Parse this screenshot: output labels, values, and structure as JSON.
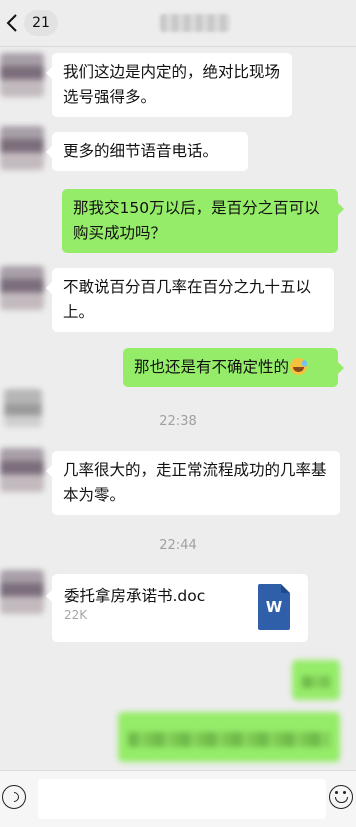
{
  "header": {
    "back_icon": "chevron-left-icon",
    "unread_count": "21"
  },
  "messages": [
    {
      "side": "left",
      "text": "我们这边是内定的，绝对比现场选号强得多。"
    },
    {
      "side": "left",
      "text": "更多的细节语音电话。"
    },
    {
      "side": "right",
      "text": "那我交150万以后，是百分之百可以购买成功吗？"
    },
    {
      "side": "left",
      "text": "不敢说百分百几率在百分之九十五以上。"
    },
    {
      "side": "right",
      "text": "那也还是有不确定性的",
      "emoji": "sweat-laugh-emoji"
    },
    {
      "type": "time",
      "text": "22:38"
    },
    {
      "side": "left",
      "text": "几率很大的，走正常流程成功的几率基本为零。"
    },
    {
      "type": "time",
      "text": "22:44"
    },
    {
      "side": "left",
      "type": "file",
      "file_name": "委托拿房承诺书.doc",
      "file_size": "22K",
      "file_icon": "word-doc-icon",
      "file_icon_letter": "W"
    }
  ],
  "colors": {
    "background": "#ededed",
    "bubble_left": "#ffffff",
    "bubble_right": "#95ec69",
    "time_text": "#a0a0a0"
  },
  "input_bar": {
    "voice_icon": "voice-icon",
    "emoji_icon": "emoji-icon",
    "input_value": ""
  }
}
